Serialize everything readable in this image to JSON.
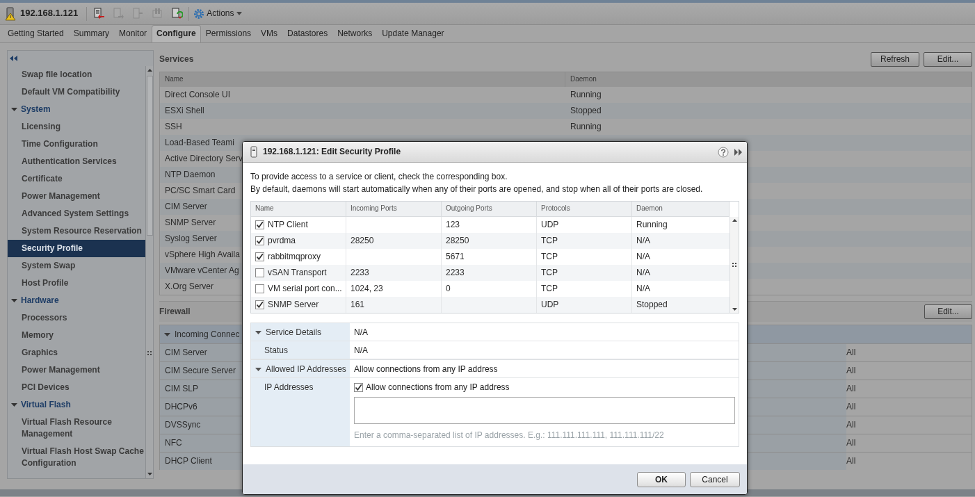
{
  "header": {
    "title": "192.168.1.121",
    "actions_label": "Actions",
    "toolbar_buttons": [
      {
        "kind": "enter",
        "disabled": false
      },
      {
        "kind": "exit",
        "disabled": true
      },
      {
        "kind": "shutdown",
        "disabled": true
      },
      {
        "kind": "standby",
        "disabled": true
      },
      {
        "kind": "reboot",
        "disabled": false
      }
    ]
  },
  "tabs": [
    {
      "label": "Getting Started",
      "selected": false
    },
    {
      "label": "Summary",
      "selected": false
    },
    {
      "label": "Monitor",
      "selected": false
    },
    {
      "label": "Configure",
      "selected": true
    },
    {
      "label": "Permissions",
      "selected": false
    },
    {
      "label": "VMs",
      "selected": false
    },
    {
      "label": "Datastores",
      "selected": false
    },
    {
      "label": "Networks",
      "selected": false
    },
    {
      "label": "Update Manager",
      "selected": false
    }
  ],
  "sidebar": {
    "items": [
      {
        "kind": "item",
        "label": "Swap file location",
        "selected": false
      },
      {
        "kind": "item",
        "label": "Default VM Compatibility",
        "selected": false
      },
      {
        "kind": "group",
        "label": "System",
        "expanded": true,
        "children": [
          {
            "kind": "item",
            "label": "Licensing",
            "selected": false
          },
          {
            "kind": "item",
            "label": "Time Configuration",
            "selected": false
          },
          {
            "kind": "item",
            "label": "Authentication Services",
            "selected": false
          },
          {
            "kind": "item",
            "label": "Certificate",
            "selected": false
          },
          {
            "kind": "item",
            "label": "Power Management",
            "selected": false
          },
          {
            "kind": "item",
            "label": "Advanced System Settings",
            "selected": false
          },
          {
            "kind": "item",
            "label": "System Resource Reservation",
            "selected": false
          },
          {
            "kind": "item",
            "label": "Security Profile",
            "selected": true
          },
          {
            "kind": "item",
            "label": "System Swap",
            "selected": false
          },
          {
            "kind": "item",
            "label": "Host Profile",
            "selected": false
          }
        ]
      },
      {
        "kind": "group",
        "label": "Hardware",
        "expanded": true,
        "children": [
          {
            "kind": "item",
            "label": "Processors",
            "selected": false
          },
          {
            "kind": "item",
            "label": "Memory",
            "selected": false
          },
          {
            "kind": "item",
            "label": "Graphics",
            "selected": false
          },
          {
            "kind": "item",
            "label": "Power Management",
            "selected": false
          },
          {
            "kind": "item",
            "label": "PCI Devices",
            "selected": false
          }
        ]
      },
      {
        "kind": "group",
        "label": "Virtual Flash",
        "expanded": true,
        "children": [
          {
            "kind": "item",
            "label": "Virtual Flash Resource Management",
            "selected": false
          },
          {
            "kind": "item",
            "label": "Virtual Flash Host Swap Cache Configuration",
            "selected": false
          }
        ]
      }
    ]
  },
  "services": {
    "title": "Services",
    "buttons": [
      "Refresh",
      "Edit..."
    ],
    "columns": [
      "Name",
      "Daemon"
    ],
    "rows": [
      {
        "name": "Direct Console UI",
        "daemon": "Running"
      },
      {
        "name": "ESXi Shell",
        "daemon": "Stopped"
      },
      {
        "name": "SSH",
        "daemon": "Running"
      },
      {
        "name": "Load-Based Teami"
      },
      {
        "name": "Active Directory Serv"
      },
      {
        "name": "NTP Daemon"
      },
      {
        "name": "PC/SC Smart Card"
      },
      {
        "name": "CIM Server"
      },
      {
        "name": "SNMP Server"
      },
      {
        "name": "Syslog Server"
      },
      {
        "name": "vSphere High Availa"
      },
      {
        "name": "VMware vCenter Ag"
      },
      {
        "name": "X.Org Server"
      }
    ]
  },
  "firewall": {
    "title": "Firewall",
    "buttons": [
      "Edit..."
    ],
    "groups": [
      {
        "label": "Incoming Connec",
        "expanded": true,
        "rows": [
          {
            "name": "CIM Server",
            "column_2": "All"
          },
          {
            "name": "CIM Secure Server",
            "column_2": "All"
          },
          {
            "name": "CIM SLP",
            "column_2": "All"
          },
          {
            "name": "DHCPv6",
            "column_2": "All"
          },
          {
            "name": "DVSSync",
            "column_2": "All"
          },
          {
            "name": "NFC",
            "column_2": "All"
          },
          {
            "name": "DHCP Client",
            "column_2": "All"
          }
        ]
      }
    ]
  },
  "dialog": {
    "title": "192.168.1.121: Edit Security Profile",
    "description": [
      "To provide access to a service or client, check the corresponding box.",
      "By default, daemons will start automatically when any of their ports are opened, and stop when all of their ports are closed."
    ],
    "columns": [
      "Name",
      "Incoming Ports",
      "Outgoing Ports",
      "Protocols",
      "Daemon"
    ],
    "rows": [
      {
        "name": "NTP Client",
        "checked": true,
        "outgoing": "123",
        "protocols": "UDP",
        "daemon": "Running"
      },
      {
        "name": "pvrdma",
        "checked": true,
        "incoming": "28250",
        "outgoing": "28250",
        "protocols": "TCP",
        "daemon": "N/A"
      },
      {
        "name": "rabbitmqproxy",
        "checked": true,
        "outgoing": "5671",
        "protocols": "TCP",
        "daemon": "N/A"
      },
      {
        "name": "vSAN Transport",
        "checked": false,
        "incoming": "2233",
        "outgoing": "2233",
        "protocols": "TCP",
        "daemon": "N/A"
      },
      {
        "name": "VM serial port con...",
        "checked": false,
        "incoming": "1024, 23",
        "outgoing": "0",
        "protocols": "TCP",
        "daemon": "N/A"
      },
      {
        "name": "SNMP Server",
        "checked": true,
        "incoming": "161",
        "protocols": "UDP",
        "daemon": "Stopped"
      }
    ],
    "details": [
      {
        "kind": "section",
        "label": "Service Details",
        "expanded": true,
        "value": "N/A"
      },
      {
        "kind": "field",
        "label": "Status",
        "value": "N/A"
      },
      {
        "kind": "section",
        "label": "Allowed IP Addresses",
        "expanded": true,
        "value": "Allow connections from any IP address"
      },
      {
        "kind": "ip",
        "label": "IP Addresses",
        "checkbox": {
          "label": "Allow connections from any IP address",
          "checked": true
        },
        "help": "Enter a comma-separated list of IP addresses. E.g.: 111.111.111.111, 111.111.111/22"
      }
    ],
    "buttons": [
      "OK",
      "Cancel"
    ]
  }
}
